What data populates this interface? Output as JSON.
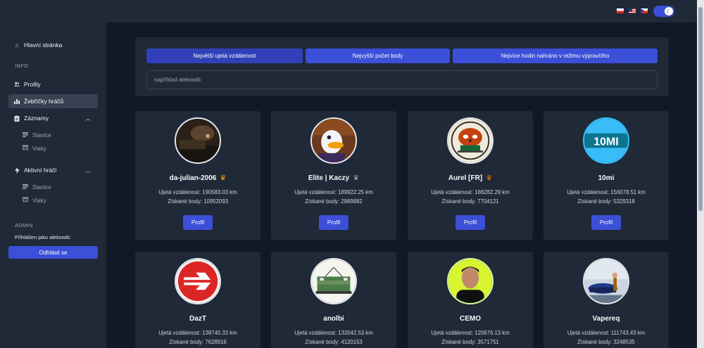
{
  "header": {
    "flags": [
      "flag-pl",
      "flag-us",
      "flag-cz"
    ],
    "theme_icon": "moon-icon"
  },
  "sidebar": {
    "home": "Hlavní stránka",
    "info_label": "INFO",
    "profiles": "Profily",
    "leaderboards": "Žebříčky hráčů",
    "records": "Záznamy",
    "records_items": [
      "Stanice",
      "Vlaky"
    ],
    "active_players": "Aktivní hráči",
    "active_items": [
      "Stanice",
      "Vlaky"
    ],
    "admin_label": "ADMIN",
    "logged_in_as": "Přihlášen jako alekswilc",
    "logout": "Odhlásit se"
  },
  "filters": {
    "distance": "Největší ujetá vzdálenost",
    "points": "Nejvyšší počet body",
    "dispatcher": "Nejvíce hodin nahráno v režimu výpravčího",
    "search_placeholder": "například alekswilc"
  },
  "colors": {
    "accent": "#3b4fd8",
    "gold": "#f59e0b",
    "silver": "#9ca3af",
    "bronze": "#d97706"
  },
  "players": [
    {
      "name": "da-julian-2006",
      "distance": "Ujetá vzdálenost: 190583.03 km",
      "points": "Získané body: 10952093",
      "crown": "♛",
      "crown_color": "#f59e0b",
      "button": "Profil"
    },
    {
      "name": "Elite | Kaczy",
      "distance": "Ujetá vzdálenost: 189922.25 km",
      "points": "Získané body: 2889882",
      "crown": "♛",
      "crown_color": "#9ca3af",
      "button": "Profil"
    },
    {
      "name": "Aurel [FR]",
      "distance": "Ujetá vzdálenost: 186282.29 km",
      "points": "Získané body: 7704121",
      "crown": "♛",
      "crown_color": "#d97706",
      "button": "Profil"
    },
    {
      "name": "10mi",
      "distance": "Ujetá vzdálenost: 156078.51 km",
      "points": "Získané body: 5329318",
      "crown": "",
      "crown_color": "",
      "button": "Profil"
    },
    {
      "name": "DazT",
      "distance": "Ujetá vzdálenost: 138740.33 km",
      "points": "Získané body: 7628916",
      "crown": "",
      "crown_color": "",
      "button": "Profil"
    },
    {
      "name": "anolbi",
      "distance": "Ujetá vzdálenost: 132042.53 km",
      "points": "Získané body: 4120153",
      "crown": "",
      "crown_color": "",
      "button": "Profil"
    },
    {
      "name": "CEMO",
      "distance": "Ujetá vzdálenost: 120676.13 km",
      "points": "Získané body: 3571751",
      "crown": "",
      "crown_color": "",
      "button": "Profil"
    },
    {
      "name": "Vapereq",
      "distance": "Ujetá vzdálenost: 111743.43 km",
      "points": "Získané body: 3248535",
      "crown": "",
      "crown_color": "",
      "button": "Profil"
    }
  ],
  "avatar_logo_text": "10MI"
}
